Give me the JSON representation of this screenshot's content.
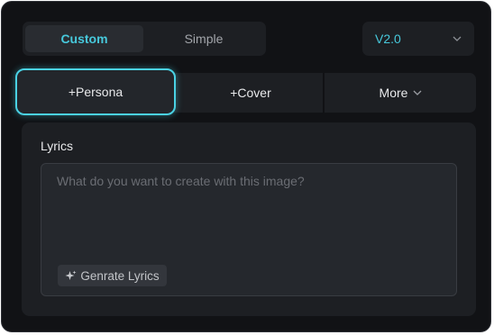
{
  "mode_toggle": {
    "options": [
      "Custom",
      "Simple"
    ],
    "selected": "Custom"
  },
  "version_select": {
    "value": "V2.0",
    "icon": "chevron-down-icon"
  },
  "actions": {
    "persona_label": "+Persona",
    "cover_label": "+Cover",
    "more_label": "More",
    "more_icon": "chevron-down-icon"
  },
  "lyrics": {
    "label": "Lyrics",
    "input_value": "",
    "placeholder": "What do you want to create with this image?",
    "generate_label": "Genrate Lyrics",
    "generate_icon": "sparkle-icon"
  },
  "colors": {
    "accent": "#47c9dc",
    "focus_border": "#4ad2e4",
    "background": "#111215",
    "surface": "#1d1f23"
  }
}
